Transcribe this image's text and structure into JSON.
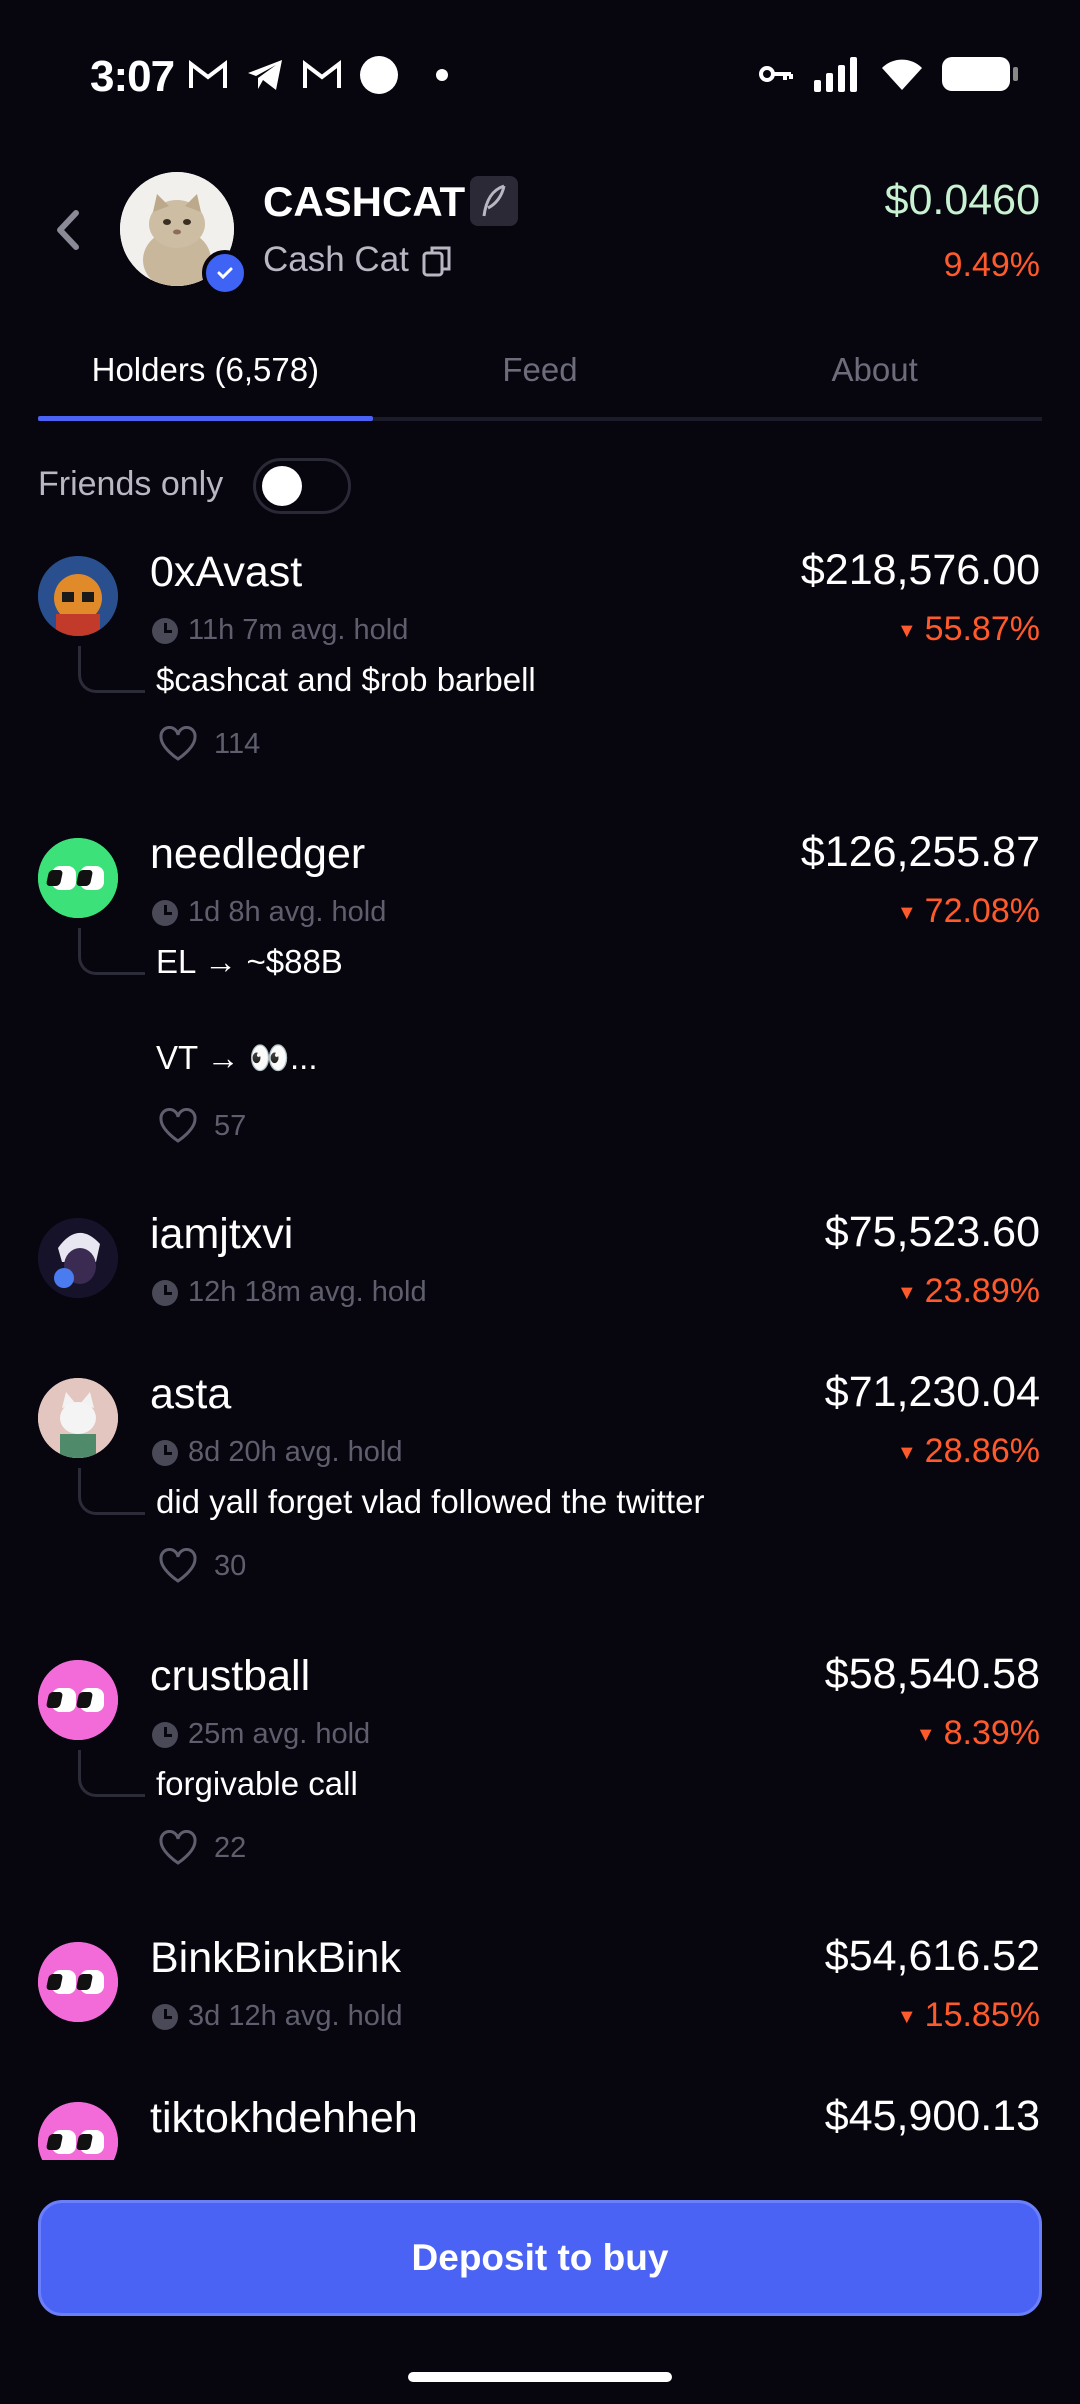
{
  "status_bar": {
    "time": "3:07"
  },
  "header": {
    "ticker": "CASHCAT",
    "name": "Cash Cat",
    "price": "$0.0460",
    "change": "9.49%"
  },
  "tabs": [
    {
      "label": "Holders (6,578)",
      "active": true
    },
    {
      "label": "Feed",
      "active": false
    },
    {
      "label": "About",
      "active": false
    }
  ],
  "filter": {
    "friends_only_label": "Friends only",
    "friends_only_on": false
  },
  "holders": [
    {
      "name": "0xAvast",
      "hold": "11h 7m avg. hold",
      "value": "$218,576.00",
      "change": "55.87%",
      "post": "$cashcat and $rob barbell",
      "likes": "114"
    },
    {
      "name": "needledger",
      "hold": "1d 8h avg. hold",
      "value": "$126,255.87",
      "change": "72.08%",
      "post": "EL → ~$88B\n\nVT → 👀...",
      "likes": "57"
    },
    {
      "name": "iamjtxvi",
      "hold": "12h 18m avg. hold",
      "value": "$75,523.60",
      "change": "23.89%"
    },
    {
      "name": "asta",
      "hold": "8d 20h avg. hold",
      "value": "$71,230.04",
      "change": "28.86%",
      "post": "did yall forget vlad followed the twitter",
      "likes": "30"
    },
    {
      "name": "crustball",
      "hold": "25m avg. hold",
      "value": "$58,540.58",
      "change": "8.39%",
      "post": "forgivable call",
      "likes": "22"
    },
    {
      "name": "BinkBinkBink",
      "hold": "3d 12h avg. hold",
      "value": "$54,616.52",
      "change": "15.85%"
    },
    {
      "name": "tiktokhdehheh",
      "value": "$45,900.13"
    }
  ],
  "actions": {
    "deposit_label": "Deposit to buy"
  },
  "colors": {
    "accent": "#4b63f5",
    "negative": "#ff5a2b",
    "price": "#c8f2d2",
    "background": "#07060f"
  }
}
